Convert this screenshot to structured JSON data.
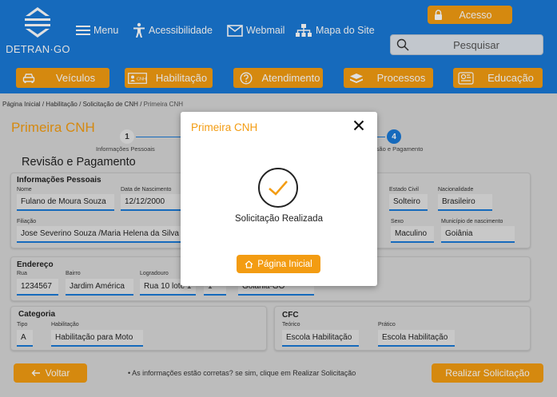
{
  "header": {
    "logo_text": "DETRAN·GO",
    "nav": {
      "menu": "Menu",
      "acessibilidade": "Acessibilidade",
      "webmail": "Webmail",
      "mapa": "Mapa do Site"
    },
    "acesso_label": "Acesso",
    "search_placeholder": "Pesquisar"
  },
  "categories": [
    {
      "label": "Veículos",
      "icon": "car-icon"
    },
    {
      "label": "Habilitação",
      "icon": "license-card-icon"
    },
    {
      "label": "Atendimento",
      "icon": "help-circle-icon"
    },
    {
      "label": "Processos",
      "icon": "stack-icon"
    },
    {
      "label": "Educação",
      "icon": "traffic-signs-icon"
    }
  ],
  "breadcrumb": {
    "items": [
      "Página Inicial",
      "Habilitação",
      "Solicitação de CNH"
    ],
    "current": "Primeira CNH",
    "separator": "/"
  },
  "page": {
    "title": "Primeira CNH",
    "section_title": "Revisão e Pagamento"
  },
  "stepper": {
    "steps": [
      {
        "number": "1",
        "label": "Informações Pessoais",
        "active": false
      },
      {
        "number": "4",
        "label": "isão e Pagamento",
        "active": true
      }
    ]
  },
  "personal": {
    "title": "Informações Pessoais",
    "nome_label": "Nome",
    "nome": "Fulano de Moura Souza",
    "nasc_label": "Data de Nascimento",
    "nasc": "12/12/2000",
    "estado_civil_label": "Estado Civil",
    "estado_civil": "Solteiro",
    "nacionalidade_label": "Nacionalidade",
    "nacionalidade": "Brasileiro",
    "filiacao_label": "Filiação",
    "filiacao": "Jose Severino Souza /Maria Helena da Silva",
    "sexo_label": "Sexo",
    "sexo": "Maculino",
    "municipio_label": "Município de nascimento",
    "municipio": "Goiânia"
  },
  "address": {
    "title": "Endereço",
    "cep_label": "Rua",
    "cep": "1234567",
    "bairro_label": "Bairro",
    "bairro": "Jardim América",
    "logradouro_label": "Logradouro",
    "logradouro": "Rua 10 lote 1",
    "numero": "1",
    "cidade": "Goiânia-GO"
  },
  "category": {
    "title": "Categoria",
    "tipo_label": "Tipo",
    "tipo": "A",
    "habilitacao_label": "Habilitação",
    "habilitacao": "Habilitação para Moto"
  },
  "cfc": {
    "title": "CFC",
    "teorico_label": "Teórico",
    "teorico": "Escola Habilitação",
    "pratico_label": "Prático",
    "pratico": "Escola Habilitação"
  },
  "footer": {
    "voltar": "Voltar",
    "notice": "• As informações estão corretas? se sim, clique em Realizar Solicitação",
    "realizar": "Realizar Solicitação"
  },
  "modal": {
    "title": "Primeira CNH",
    "message": "Solicitação Realizada",
    "button": "Página Inicial"
  },
  "colors": {
    "primary": "#1a79d6",
    "accent": "#f39c12",
    "background": "#d6d6d6"
  }
}
